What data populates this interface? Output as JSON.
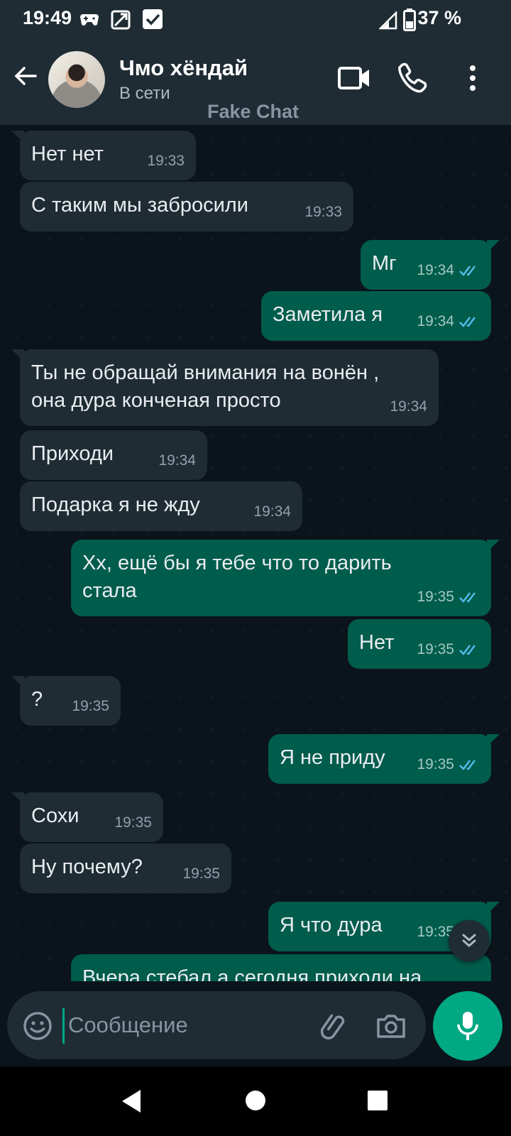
{
  "status_bar": {
    "time": "19:49",
    "battery": "37 %"
  },
  "header": {
    "contact_name": "Чмо хёндай",
    "contact_status": "В сети",
    "watermark": "Fake Chat"
  },
  "messages": [
    {
      "dir": "in",
      "text": "Нет нет",
      "time": "19:33"
    },
    {
      "dir": "in",
      "text": "С таким мы забросили",
      "time": "19:33"
    },
    {
      "dir": "out",
      "text": "Мг",
      "time": "19:34"
    },
    {
      "dir": "out",
      "text": "Заметила я",
      "time": "19:34"
    },
    {
      "dir": "in",
      "text": "Ты не обращай внимания на вонён ,\nона дура конченая просто",
      "time": "19:34"
    },
    {
      "dir": "in",
      "text": "Приходи",
      "time": "19:34"
    },
    {
      "dir": "in",
      "text": "Подарка я не жду",
      "time": "19:34"
    },
    {
      "dir": "out",
      "text": "Хх, ещё бы я тебе что то дарить\nстала",
      "time": "19:35"
    },
    {
      "dir": "out",
      "text": "Нет",
      "time": "19:35"
    },
    {
      "dir": "in",
      "text": "?",
      "time": "19:35"
    },
    {
      "dir": "out",
      "text": "Я не приду",
      "time": "19:35"
    },
    {
      "dir": "in",
      "text": "Сохи",
      "time": "19:35"
    },
    {
      "dir": "in",
      "text": "Ну почему?",
      "time": "19:35"
    },
    {
      "dir": "out",
      "text": "Я что дура",
      "time": "19:35"
    },
    {
      "dir": "out",
      "text": "Вчера стебал а сегодня приходи на",
      "time": ""
    }
  ],
  "composer": {
    "placeholder": "Сообщение"
  },
  "colors": {
    "incoming": "#1f2c34",
    "outgoing": "#005c4b",
    "accent": "#00a884",
    "read_tick": "#53bdeb"
  }
}
